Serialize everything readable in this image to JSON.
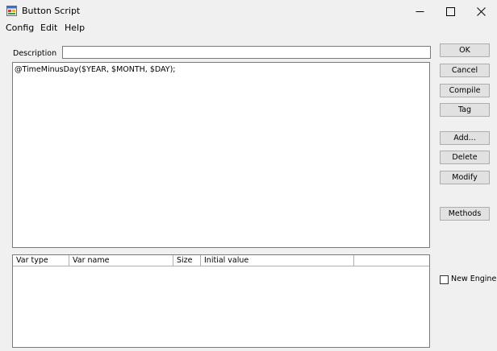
{
  "window": {
    "title": "Button Script",
    "controls": {
      "minimize": "—",
      "maximize": "☐",
      "close": "✕"
    }
  },
  "menu": {
    "items": [
      {
        "label": "Config"
      },
      {
        "label": "Edit"
      },
      {
        "label": "Help"
      }
    ]
  },
  "description": {
    "label": "Description",
    "value": ""
  },
  "script": {
    "text": "@TimeMinusDay($YEAR, $MONTH, $DAY);"
  },
  "var_table": {
    "columns": [
      "Var type",
      "Var name",
      "Size",
      "Initial value",
      ""
    ],
    "rows": []
  },
  "buttons": {
    "ok": "OK",
    "cancel": "Cancel",
    "compile": "Compile",
    "tag": "Tag",
    "add": "Add...",
    "delete": "Delete",
    "modify": "Modify",
    "methods": "Methods"
  },
  "new_engine": {
    "label": "New Engine",
    "checked": false
  },
  "icons": {
    "app": "app-window-icon"
  }
}
